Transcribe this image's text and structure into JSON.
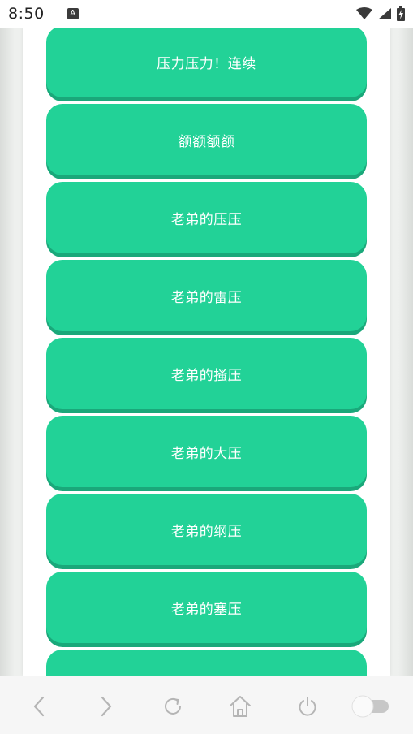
{
  "status_bar": {
    "time": "8:50",
    "notification_icon": "A"
  },
  "buttons": [
    {
      "label": "压力压力！连续"
    },
    {
      "label": "额额额额"
    },
    {
      "label": "老弟的压压"
    },
    {
      "label": "老弟的雷压"
    },
    {
      "label": "老弟的搔压"
    },
    {
      "label": "老弟的大压"
    },
    {
      "label": "老弟的纲压"
    },
    {
      "label": "老弟的塞压"
    },
    {
      "label": ""
    }
  ],
  "nav_bar": {
    "icons": [
      "back-icon",
      "forward-icon",
      "refresh-icon",
      "home-icon",
      "power-icon",
      "toggle-switch"
    ]
  },
  "colors": {
    "button_bg": "#22d297",
    "button_shadow": "#1aa87a"
  }
}
